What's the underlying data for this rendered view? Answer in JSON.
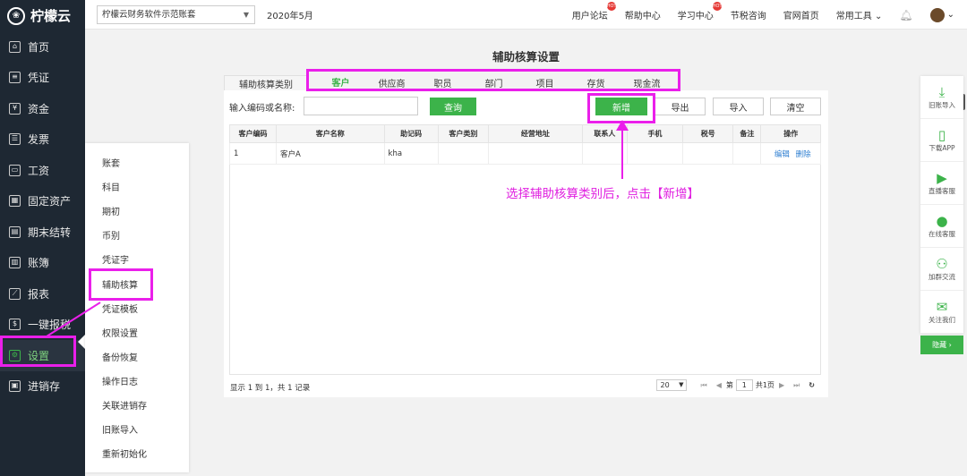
{
  "app": {
    "name": "柠檬云"
  },
  "sidebar": {
    "items": [
      {
        "label": "首页",
        "icon": "home-icon"
      },
      {
        "label": "凭证",
        "icon": "voucher-icon"
      },
      {
        "label": "资金",
        "icon": "fund-icon"
      },
      {
        "label": "发票",
        "icon": "invoice-icon"
      },
      {
        "label": "工资",
        "icon": "salary-icon"
      },
      {
        "label": "固定资产",
        "icon": "asset-icon"
      },
      {
        "label": "期末结转",
        "icon": "closing-icon"
      },
      {
        "label": "账簿",
        "icon": "ledger-icon"
      },
      {
        "label": "报表",
        "icon": "report-icon"
      },
      {
        "label": "一键报税",
        "icon": "tax-icon"
      },
      {
        "label": "设置",
        "icon": "gear-icon"
      },
      {
        "label": "进销存",
        "icon": "inventory-icon"
      }
    ],
    "active": "设置"
  },
  "topbar": {
    "account": "柠檬云财务软件示范账套",
    "period": "2020年5月",
    "links": [
      "用户论坛",
      "帮助中心",
      "学习中心",
      "节税咨询",
      "官网首页",
      "常用工具"
    ],
    "hot_badge": "HOT"
  },
  "submenu": {
    "items": [
      "账套",
      "科目",
      "期初",
      "币别",
      "凭证字",
      "辅助核算",
      "凭证模板",
      "权限设置",
      "备份恢复",
      "操作日志",
      "关联进销存",
      "旧账导入",
      "重新初始化"
    ]
  },
  "page": {
    "title": "辅助核算设置"
  },
  "tabs": {
    "first": "辅助核算类别",
    "items": [
      "客户",
      "供应商",
      "职员",
      "部门",
      "项目",
      "存货",
      "现金流"
    ],
    "active": "客户"
  },
  "toolbar": {
    "query_label": "输入编码或名称:",
    "query_placeholder": "",
    "query_button": "查询",
    "add": "新增",
    "export": "导出",
    "import": "导入",
    "clear": "清空"
  },
  "table": {
    "columns": [
      "客户编码",
      "客户名称",
      "助记码",
      "客户类别",
      "经营地址",
      "联系人",
      "手机",
      "税号",
      "备注",
      "操作"
    ],
    "rows": [
      {
        "code": "1",
        "name": "客户A",
        "mnemonic": "kha",
        "category": "",
        "address": "",
        "contact": "",
        "phone": "",
        "tax_id": "",
        "note": "",
        "edit": "编辑",
        "delete": "删除"
      }
    ]
  },
  "footer": {
    "info": "显示 1 到 1，共 1 记录",
    "page_size": "20",
    "page_prefix": "第",
    "page_current": "1",
    "page_suffix": "共1页"
  },
  "annotation": {
    "text": "选择辅助核算类别后，点击【新增】"
  },
  "right_panel": {
    "items": [
      {
        "label": "旧账导入",
        "icon": "import-icon"
      },
      {
        "label": "下载APP",
        "icon": "phone-icon"
      },
      {
        "label": "直播客服",
        "icon": "video-icon"
      },
      {
        "label": "在线客服",
        "icon": "person-icon"
      },
      {
        "label": "加群交流",
        "icon": "group-icon"
      },
      {
        "label": "关注我们",
        "icon": "wechat-icon"
      }
    ],
    "hide": "隐藏 ›"
  },
  "colors": {
    "accent": "#3cb34a",
    "annotation": "#ea1fea",
    "sidebar_bg": "#1e2833",
    "link": "#2f7fd1"
  }
}
